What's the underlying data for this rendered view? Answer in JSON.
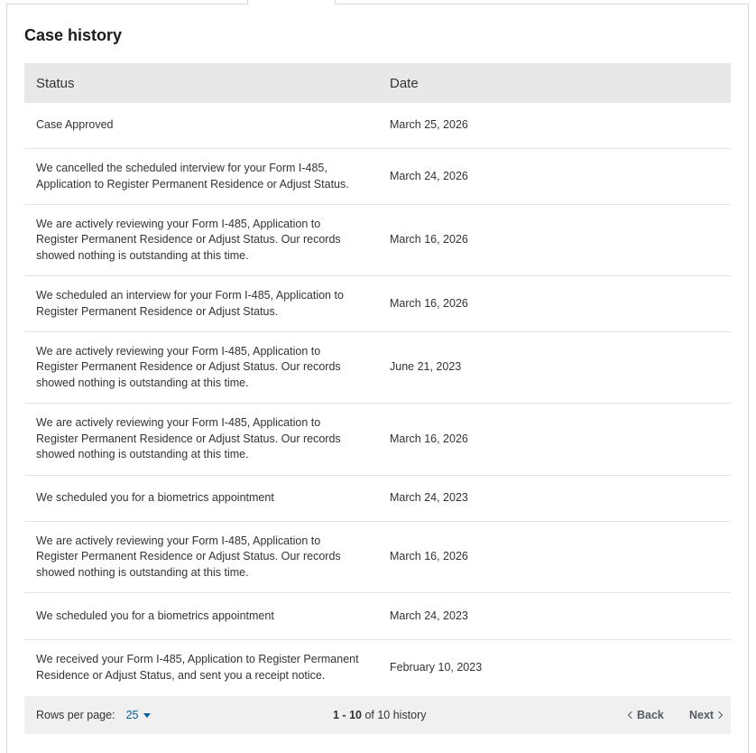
{
  "title": "Case history",
  "table": {
    "headers": {
      "status": "Status",
      "date": "Date"
    },
    "rows": [
      {
        "status": "Case Approved",
        "date": "March 25, 2026"
      },
      {
        "status": "We cancelled the scheduled interview for your Form I-485, Application to Register Permanent Residence or Adjust Status.",
        "date": "March 24, 2026"
      },
      {
        "status": "We are actively reviewing your Form I-485, Application to Register Permanent Residence or Adjust Status. Our records showed nothing is outstanding at this time.",
        "date": "March 16, 2026"
      },
      {
        "status": "We scheduled an interview for your Form I-485, Application to Register Permanent Residence or Adjust Status.",
        "date": "March 16, 2026"
      },
      {
        "status": "We are actively reviewing your Form I-485, Application to Register Permanent Residence or Adjust Status. Our records showed nothing is outstanding at this time.",
        "date": "June 21, 2023"
      },
      {
        "status": "We are actively reviewing your Form I-485, Application to Register Permanent Residence or Adjust Status. Our records showed nothing is outstanding at this time.",
        "date": "March 16, 2026"
      },
      {
        "status": "We scheduled you for a biometrics appointment",
        "date": "March 24, 2023"
      },
      {
        "status": "We are actively reviewing your Form I-485, Application to Register Permanent Residence or Adjust Status. Our records showed nothing is outstanding at this time.",
        "date": "March 16, 2026"
      },
      {
        "status": "We scheduled you for a biometrics appointment",
        "date": "March 24, 2023"
      },
      {
        "status": "We received your Form I-485, Application to Register Permanent Residence or Adjust Status, and sent you a receipt notice.",
        "date": "February 10, 2023"
      }
    ]
  },
  "pagination": {
    "rows_per_page_label": "Rows per page:",
    "rows_per_page_value": "25",
    "range_start": "1",
    "range_sep": " - ",
    "range_end": "10",
    "range_of": " of ",
    "range_total": "10",
    "range_suffix": " history",
    "back_label": "Back",
    "next_label": "Next"
  },
  "colors": {
    "link": "#005ea2",
    "header_bg": "#e8e8e8",
    "footer_bg": "#f0f0f0"
  }
}
